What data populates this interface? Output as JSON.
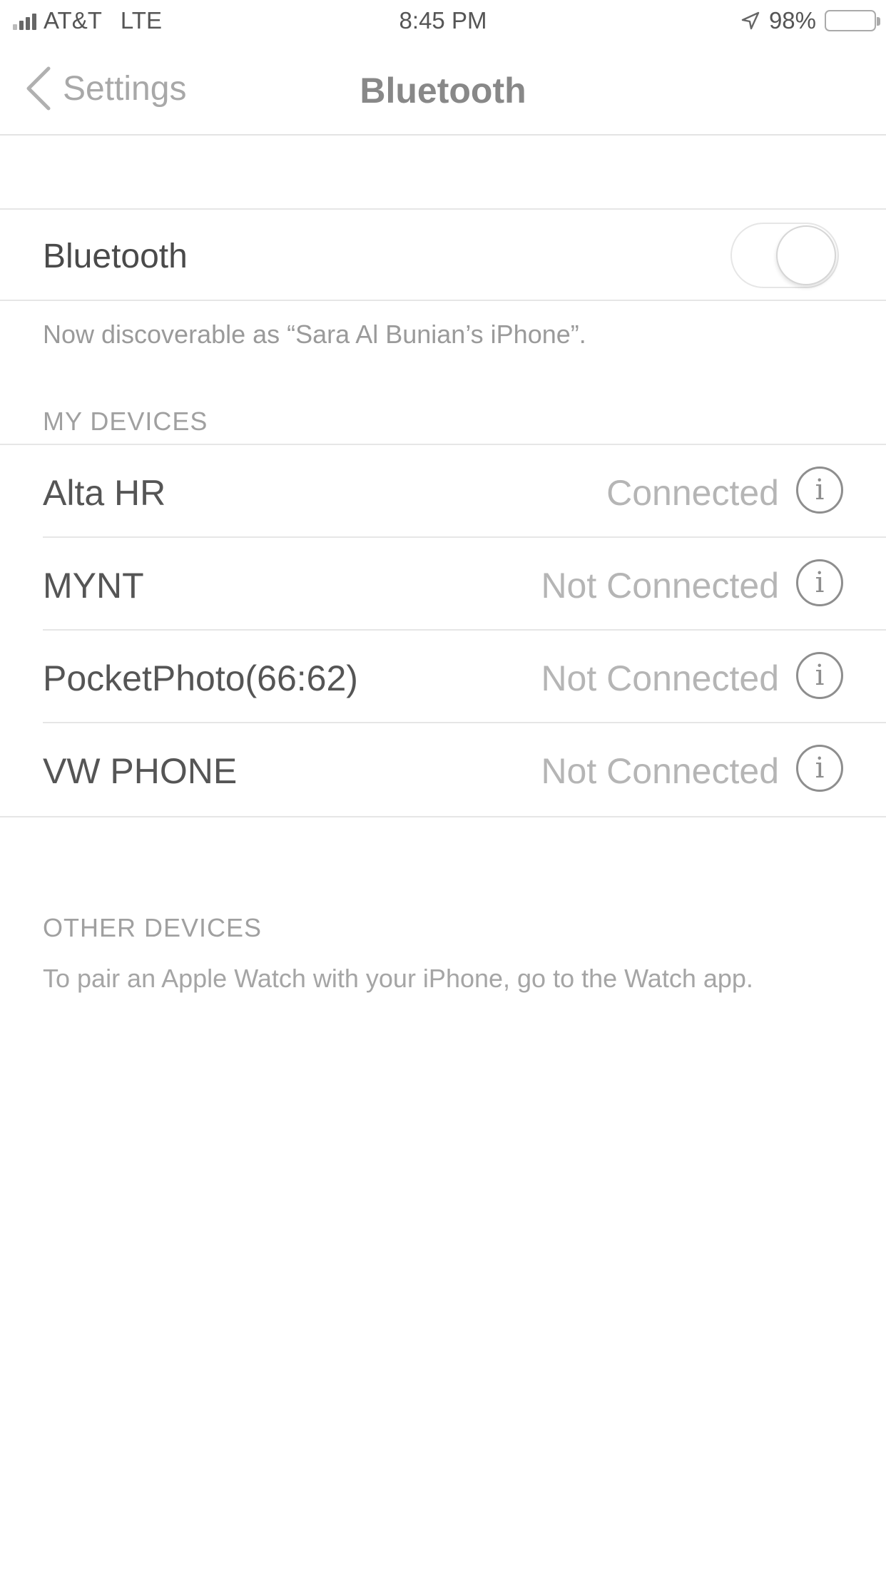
{
  "status_bar": {
    "carrier": "AT&T",
    "network": "LTE",
    "time": "8:45 PM",
    "battery": "98%",
    "battery_level": 0.98
  },
  "nav": {
    "back_label": "Settings",
    "title": "Bluetooth"
  },
  "bluetooth": {
    "label": "Bluetooth",
    "toggle_on": true,
    "discoverable_text": "Now discoverable as “Sara Al Bunian’s iPhone”."
  },
  "my_devices": {
    "header": "MY DEVICES",
    "devices": [
      {
        "name": "Alta HR",
        "status": "Connected"
      },
      {
        "name": "MYNT",
        "status": "Not Connected"
      },
      {
        "name": "PocketPhoto(66:62)",
        "status": "Not Connected"
      },
      {
        "name": "VW PHONE",
        "status": "Not Connected"
      }
    ]
  },
  "other_devices": {
    "header": "OTHER DEVICES",
    "note": "To pair an Apple Watch with your iPhone, go to the Watch app."
  },
  "icons": {
    "info": "i"
  }
}
